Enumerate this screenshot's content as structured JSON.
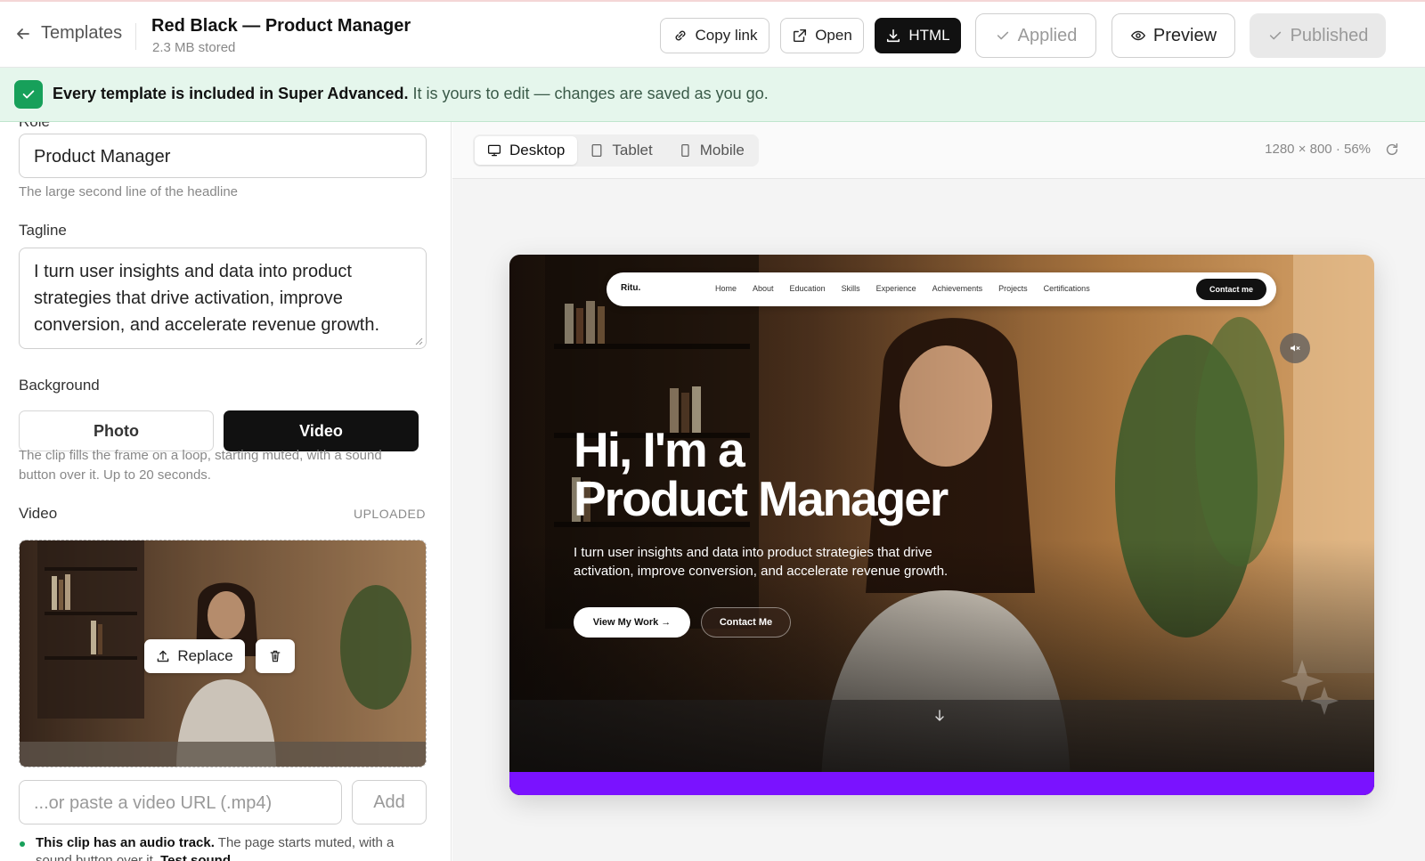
{
  "topbar": {
    "back_label": "Templates",
    "title": "Red Black — Product Manager",
    "subtitle": "2.3 MB stored",
    "copy_link": "Copy link",
    "open": "Open",
    "html": "HTML",
    "applied": "Applied",
    "preview": "Preview",
    "published": "Published"
  },
  "banner": {
    "bold": "Every template is included in Super Advanced.",
    "rest": "It is yours to edit — changes are saved as you go."
  },
  "form": {
    "cut_label": "Role",
    "role_value": "Product Manager",
    "role_hint": "The large second line of the headline",
    "tagline_label": "Tagline",
    "tagline_value": "I turn user insights and data into product strategies that drive activation, improve conversion, and accelerate revenue growth.",
    "background_label": "Background",
    "bg_photo": "Photo",
    "bg_video": "Video",
    "bg_hint": "The clip fills the frame on a loop, starting muted, with a sound button over it. Up to 20 seconds.",
    "video_label": "Video",
    "video_status": "UPLOADED",
    "replace": "Replace",
    "url_placeholder": "...or paste a video URL (.mp4)",
    "add": "Add",
    "audio_bold": "This clip has an audio track.",
    "audio_rest": "The page starts muted, with a sound button over it.",
    "test_sound": "Test sound"
  },
  "preview": {
    "tabs": [
      "Desktop",
      "Tablet",
      "Mobile"
    ],
    "dims": "1280 × 800 · 56%"
  },
  "site": {
    "brand": "Ritu.",
    "nav": [
      "Home",
      "About",
      "Education",
      "Skills",
      "Experience",
      "Achievements",
      "Projects",
      "Certifications"
    ],
    "nav_cta": "Contact me",
    "hero_line1": "Hi, I'm a",
    "hero_line2": "Product Manager",
    "hero_text": "I turn user insights and data into product strategies that drive activation, improve conversion, and accelerate revenue growth.",
    "btn_work": "View My Work →",
    "btn_contact": "Contact Me"
  },
  "colors": {
    "accent_green": "#17a05a",
    "banner_bg": "#e5f6ec",
    "purple_bar": "#7a12ff",
    "dark": "#111111"
  }
}
